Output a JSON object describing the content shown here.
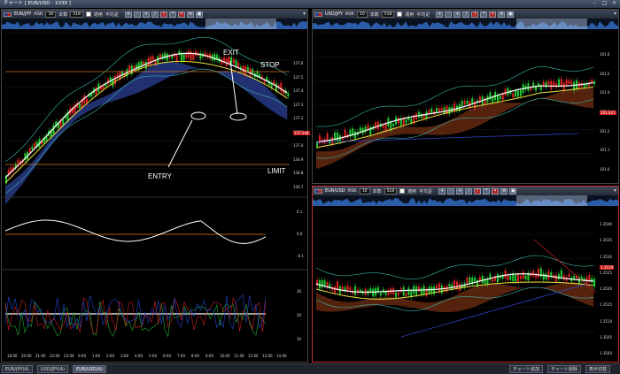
{
  "window": {
    "title": "チャート [ EUR/USD - 1039 ]"
  },
  "panels": [
    {
      "symbol": "EUR/JPY",
      "side": "ASK",
      "count_label": "本数",
      "count": "10",
      "bars": "518",
      "apply_label": "適用",
      "avg_label": "平均足",
      "price_tag": "137.246",
      "y_ticks": [
        "137.6",
        "137.5",
        "137.4",
        "137.3",
        "137.2",
        "137.1",
        "137.0",
        "136.9",
        "136.8",
        "136.7"
      ],
      "sub1_ticks": [
        "0.1",
        "0.0",
        "-0.1"
      ],
      "sub2_ticks": [
        "30",
        "20",
        "10"
      ],
      "x_ticks": [
        "18:00",
        "20:00",
        "21:00",
        "22:00",
        "23:00",
        "0:00",
        "1:00",
        "2:00",
        "3:00",
        "4:00",
        "5:00",
        "6:00",
        "7:00",
        "8:00",
        "9:00",
        "10:00",
        "11:00",
        "12:00",
        "13:00",
        "14:00"
      ],
      "annotations": {
        "exit": "EXIT",
        "stop": "STOP",
        "entry": "ENTRY",
        "limit": "LIMIT"
      }
    },
    {
      "symbol": "USD/JPY",
      "side": "ASK",
      "count_label": "本数",
      "count": "10",
      "bars": "518",
      "apply_label": "適用",
      "avg_label": "平均足",
      "price_tag": "101.427",
      "y_ticks": [
        "101.6",
        "101.5",
        "101.4",
        "101.3",
        "101.2",
        "101.1",
        "101.0"
      ]
    },
    {
      "symbol": "EUR/USD",
      "side": "ASK",
      "count_label": "本数",
      "count": "10",
      "bars": "518",
      "apply_label": "適用",
      "avg_label": "平均足",
      "price_tag": "1.3519",
      "y_ticks": [
        "1.3540",
        "1.3535",
        "1.3530",
        "1.3525",
        "1.3520",
        "1.3515",
        "1.3510",
        "1.3505",
        "1.3500"
      ]
    }
  ],
  "tabs": [
    "EUR/JPY(A)",
    "USD/JPY(A)",
    "EUR/USD(A)"
  ],
  "bottom_buttons": [
    "チャート追加",
    "チャート削除",
    "表示切替"
  ],
  "colors": {
    "bull": "#22cc33",
    "bear": "#dd2222",
    "tenkan": "#ffffff",
    "kijun": "#f0e040",
    "cloud_up": "#283c8c",
    "cloud_down": "#6a2a10",
    "band": "#3cb8b0",
    "accent": "#c0302a"
  }
}
